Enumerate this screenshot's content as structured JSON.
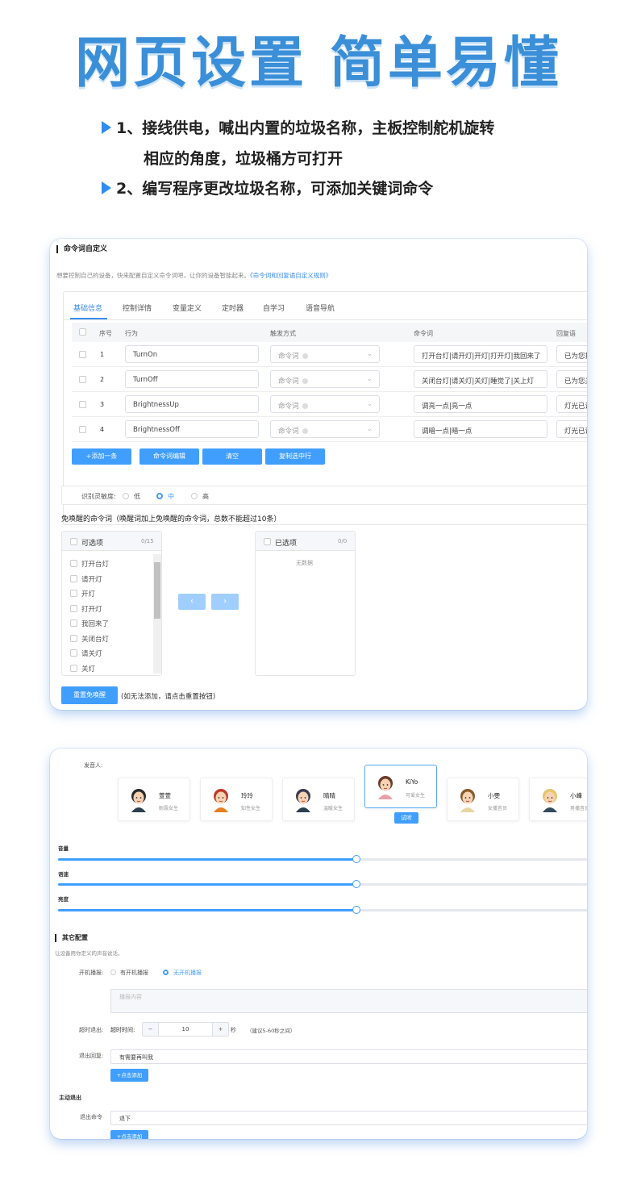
{
  "hero": {
    "title": "网页设置 简单易懂"
  },
  "bullets": {
    "b1_line1": "1、接线供电，喊出内置的垃圾名称，主板控制舵机旋转",
    "b1_line2": "相应的角度，垃圾桶方可打开",
    "b2": "2、编写程序更改垃圾名称，可添加关键词命令"
  },
  "card1": {
    "title": "命令词自定义",
    "desc": "想要控制自己的设备，快来配置自定义命令词吧，让你的设备智能起来。",
    "desc_link": "《命令词和回复语自定义规则》",
    "tabs": [
      "基础信息",
      "控制详情",
      "变量定义",
      "定时器",
      "自学习",
      "语音导航"
    ],
    "columns": {
      "idx": "序号",
      "action": "行为",
      "trigger": "触发方式",
      "command": "命令词",
      "reply": "回复语"
    },
    "rows": [
      {
        "idx": "1",
        "action": "TurnOn",
        "trigger": "命令词",
        "command": "打开台灯|请开灯|开灯|打开灯|我回来了",
        "reply": "已为您打"
      },
      {
        "idx": "2",
        "action": "TurnOff",
        "trigger": "命令词",
        "command": "关闭台灯|请关灯|关灯|睡觉了|关上灯",
        "reply": "已为您关"
      },
      {
        "idx": "3",
        "action": "BrightnessUp",
        "trigger": "命令词",
        "command": "调亮一点|亮一点",
        "reply": "灯光已调"
      },
      {
        "idx": "4",
        "action": "BrightnessOff",
        "trigger": "命令词",
        "command": "调暗一点|暗一点",
        "reply": "灯光已调"
      }
    ],
    "buttons": {
      "add": "+添加一条",
      "edit": "命令词编辑",
      "clear": "清空",
      "copy": "复制选中行"
    },
    "sensitivity": {
      "label": "识别灵敏度:",
      "low": "低",
      "mid": "中",
      "high": "高"
    },
    "wake_title": "免唤醒的命令词（唤醒词加上免唤醒的命令词，总数不能超过10条）",
    "left_panel": {
      "title": "可选项",
      "count": "0/15",
      "items": [
        "打开台灯",
        "请开灯",
        "开灯",
        "打开灯",
        "我回来了",
        "关闭台灯",
        "请关灯",
        "关灯"
      ]
    },
    "right_panel": {
      "title": "已选项",
      "count": "0/0",
      "empty": "无数据"
    },
    "reset_button": "重置免唤醒",
    "reset_hint": "(如无法添加，请点击重置按钮)"
  },
  "card2": {
    "speaker_label": "发音人:",
    "voices": [
      {
        "name": "萱萱",
        "desc": "耐震女生"
      },
      {
        "name": "玲玲",
        "desc": "知性女生"
      },
      {
        "name": "晴晴",
        "desc": "温暖女生"
      },
      {
        "name": "KiYo",
        "desc": "可爱女生"
      },
      {
        "name": "小雯",
        "desc": "女播音员"
      },
      {
        "name": "小峰",
        "desc": "男播音员"
      }
    ],
    "audition": "试听",
    "sliders": [
      {
        "label": "音量",
        "value": 0.56
      },
      {
        "label": "语速",
        "value": 0.56
      },
      {
        "label": "亮度",
        "value": 0.56
      }
    ],
    "other_title": "其它配置",
    "other_desc": "让设备用你定义的声音说话。",
    "boot_label": "开机播报:",
    "boot_opt1": "有开机播报",
    "boot_opt2": "无开机播报",
    "boot_placeholder": "播报内容",
    "timeout_label": "超时退出:",
    "timeout_sub": "超时时间:",
    "timeout_minus": "−",
    "timeout_value": "10",
    "timeout_plus": "+",
    "timeout_unit": "秒",
    "timeout_hint": "（建议5-60秒之间）",
    "exit_reply_label": "退出回复:",
    "exit_reply_value": "有需要再叫我",
    "add_click": "+点击添加",
    "active_exit_title": "主动退出",
    "exit_cmd_label": "退出命令",
    "exit_cmd_value": "退下",
    "add_click2": "+点击添加"
  }
}
